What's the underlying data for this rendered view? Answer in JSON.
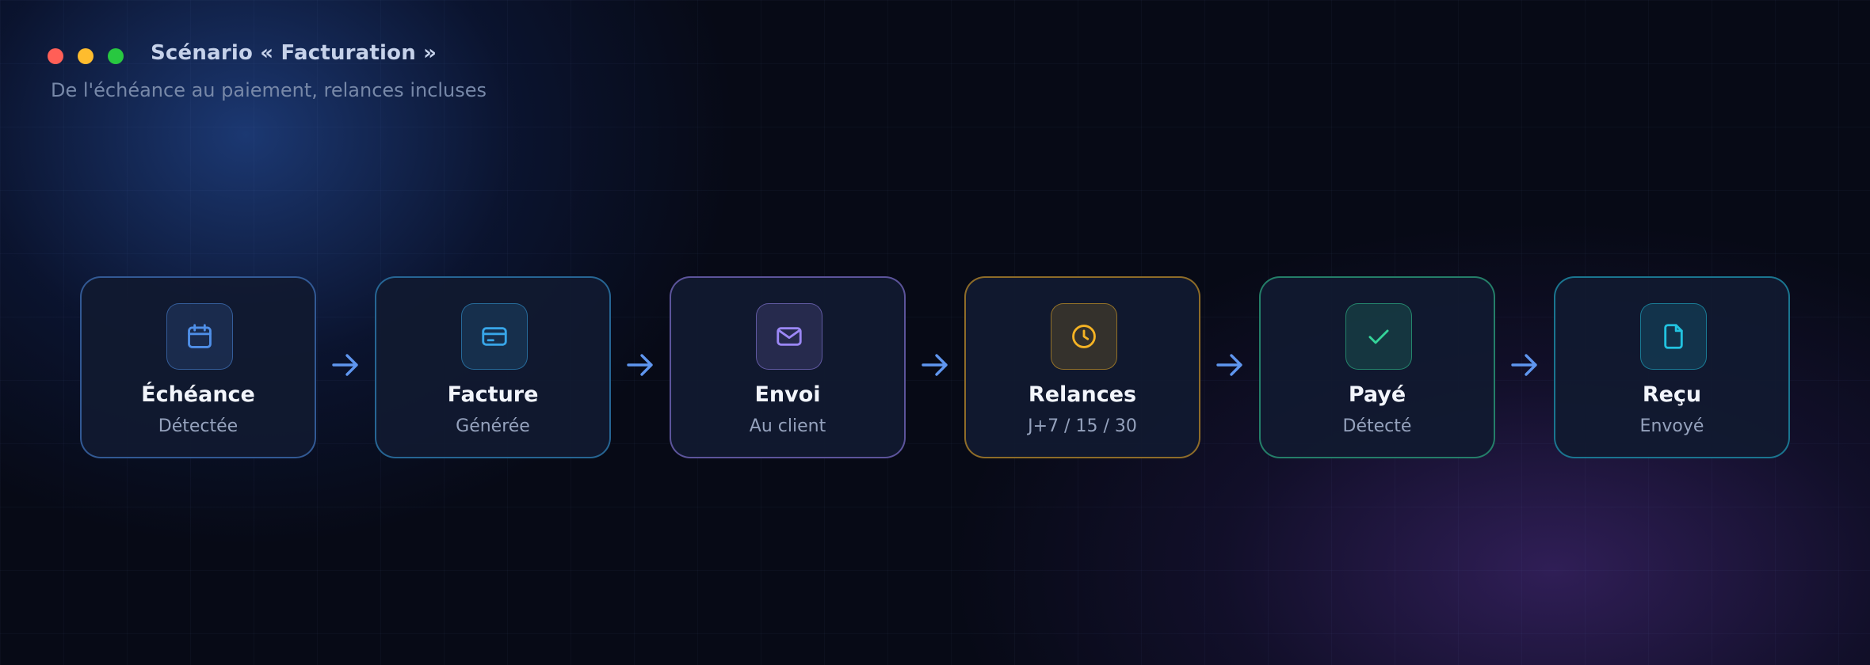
{
  "header": {
    "title": "Scénario « Facturation »",
    "subtitle": "De l'échéance au paiement, relances incluses"
  },
  "window_dots": [
    {
      "name": "close",
      "color": "#ff5f57"
    },
    {
      "name": "minimize",
      "color": "#febc2e"
    },
    {
      "name": "maximize",
      "color": "#28c840"
    }
  ],
  "steps": [
    {
      "title": "Échéance",
      "subtitle": "Détectée",
      "icon": "calendar-icon",
      "accent": "#4f8fe8"
    },
    {
      "title": "Facture",
      "subtitle": "Générée",
      "icon": "credit-card-icon",
      "accent": "#38a6e8"
    },
    {
      "title": "Envoi",
      "subtitle": "Au client",
      "icon": "mail-icon",
      "accent": "#9b87f5"
    },
    {
      "title": "Relances",
      "subtitle": "J+7 / 15 / 30",
      "icon": "clock-icon",
      "accent": "#f5b324"
    },
    {
      "title": "Payé",
      "subtitle": "Détecté",
      "icon": "check-icon",
      "accent": "#34d399"
    },
    {
      "title": "Reçu",
      "subtitle": "Envoyé",
      "icon": "file-icon",
      "accent": "#22c3e0"
    }
  ],
  "connector_color": "#5f96ef"
}
